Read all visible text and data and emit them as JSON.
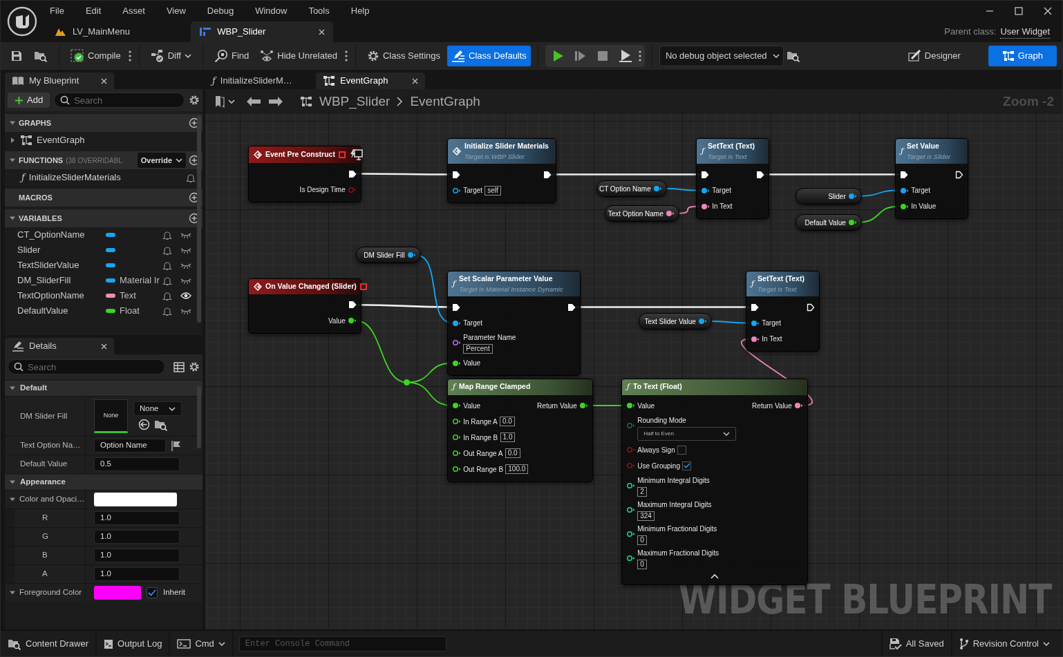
{
  "menu": [
    "File",
    "Edit",
    "Asset",
    "View",
    "Debug",
    "Window",
    "Tools",
    "Help"
  ],
  "document_tabs": [
    {
      "label": "LV_MainMenu",
      "kind": "level",
      "selected": false
    },
    {
      "label": "WBP_Slider",
      "kind": "widget",
      "selected": true
    }
  ],
  "parent_class": {
    "label": "Parent class:",
    "value": "User Widget"
  },
  "toolbar": {
    "compile": "Compile",
    "diff": "Diff",
    "find": "Find",
    "hide_unrelated": "Hide Unrelated",
    "class_modes": [
      {
        "label": "Class Settings",
        "kind": "settings",
        "selected": false
      },
      {
        "label": "Class Defaults",
        "kind": "defaults",
        "selected": true
      }
    ],
    "debug_object": "No debug object selected"
  },
  "editor_modes": [
    {
      "label": "Designer",
      "kind": "designer",
      "selected": false
    },
    {
      "label": "Graph",
      "kind": "graph",
      "selected": true
    }
  ],
  "my_blueprint": {
    "title": "My Blueprint",
    "add": "Add",
    "search_placeholder": "Search",
    "sections": [
      {
        "title": "GRAPHS",
        "items": [
          {
            "label": "EventGraph",
            "kind": "graph",
            "expanded": false
          }
        ]
      },
      {
        "title": "FUNCTIONS",
        "note": "(38 OVERRIDABL",
        "override": "Override",
        "items": [
          {
            "label": "InitializeSliderMaterials",
            "kind": "function",
            "glyph": "ƒ"
          }
        ]
      },
      {
        "title": "MACROS"
      },
      {
        "title": "VARIABLES",
        "variables": [
          {
            "name": "CT_OptionName",
            "color": "#16a6f2",
            "public": false
          },
          {
            "name": "Slider",
            "color": "#16a6f2",
            "public": false
          },
          {
            "name": "TextSliderValue",
            "color": "#16a6f2",
            "public": false
          },
          {
            "name": "DM_SliderFill",
            "color": "#16a6f2",
            "type": "Material Ir",
            "public": false
          },
          {
            "name": "TextOptionName",
            "color": "#f08cba",
            "type": "Text",
            "public": true
          },
          {
            "name": "DefaultValue",
            "color": "#3ed422",
            "type": "Float",
            "public": false
          }
        ]
      }
    ]
  },
  "details": {
    "title": "Details",
    "search_placeholder": "Search",
    "sections": [
      {
        "title": "Default",
        "rows": [
          {
            "kind": "asset",
            "label": "DM Slider Fill",
            "thumbnail": "None",
            "value": "None"
          },
          {
            "kind": "text",
            "label": "Text Option Na…",
            "value": "Option Name"
          },
          {
            "kind": "number",
            "label": "Default Value",
            "value": "0.5"
          }
        ]
      },
      {
        "title": "Appearance",
        "rows": [
          {
            "kind": "color",
            "label": "Color and Opaci…",
            "color": "#ffffff",
            "expanded": true,
            "children": [
              {
                "label": "R",
                "value": "1.0"
              },
              {
                "label": "G",
                "value": "1.0"
              },
              {
                "label": "B",
                "value": "1.0"
              },
              {
                "label": "A",
                "value": "1.0"
              }
            ]
          },
          {
            "kind": "color",
            "label": "Foreground Color",
            "color": "#ff00ff",
            "expanded": true,
            "inherit": {
              "label": "Inherit",
              "checked": true
            }
          }
        ]
      }
    ]
  },
  "graph": {
    "tabs": [
      {
        "label": "InitializeSliderM…",
        "kind": "function",
        "glyph": "ƒ",
        "selected": false
      },
      {
        "label": "EventGraph",
        "kind": "graph",
        "selected": true
      }
    ],
    "breadcrumb": [
      "WBP_Slider",
      "EventGraph"
    ],
    "zoom": "Zoom -2",
    "corner_text": "WIDGET BLUEPRINT",
    "nodes": [
      {
        "kind": "event",
        "title": "Event Pre Construct",
        "design_time": true,
        "outputs": [
          {
            "kind": "exec",
            "connected": true
          },
          {
            "kind": "bool",
            "label": "Is Design Time",
            "connected": false
          }
        ]
      },
      {
        "kind": "call",
        "title": "Initialize Slider Materials",
        "subtitle": "Target is WBP Slider",
        "inputs": [
          {
            "kind": "exec",
            "connected": true
          },
          {
            "kind": "object",
            "label": "Target",
            "value": "self",
            "connected": false
          }
        ],
        "outputs": [
          {
            "kind": "exec",
            "connected": true
          }
        ]
      },
      {
        "kind": "function",
        "glyph": "ƒ",
        "title": "SetText (Text)",
        "subtitle": "Target is Text",
        "inputs": [
          {
            "kind": "exec",
            "connected": true
          },
          {
            "kind": "object",
            "label": "Target",
            "connected": true
          },
          {
            "kind": "text",
            "label": "In Text",
            "connected": true
          }
        ],
        "outputs": [
          {
            "kind": "exec",
            "connected": true
          }
        ]
      },
      {
        "kind": "function",
        "glyph": "ƒ",
        "title": "Set Value",
        "subtitle": "Target is Slider",
        "inputs": [
          {
            "kind": "exec",
            "connected": true
          },
          {
            "kind": "object",
            "label": "Target",
            "connected": true
          },
          {
            "kind": "float",
            "label": "In Value",
            "connected": true
          }
        ],
        "outputs": [
          {
            "kind": "exec",
            "connected": false
          }
        ]
      },
      {
        "kind": "variable",
        "title": "CT Option Name",
        "outputs": [
          {
            "kind": "object",
            "connected": true
          }
        ]
      },
      {
        "kind": "variable",
        "title": "Text Option Name",
        "outputs": [
          {
            "kind": "text",
            "connected": true
          }
        ]
      },
      {
        "kind": "variable",
        "title": "Slider",
        "outputs": [
          {
            "kind": "object",
            "connected": true
          }
        ]
      },
      {
        "kind": "variable",
        "title": "Default Value",
        "outputs": [
          {
            "kind": "float",
            "connected": true
          }
        ]
      },
      {
        "kind": "variable",
        "title": "DM Slider Fill",
        "outputs": [
          {
            "kind": "object",
            "connected": true
          }
        ]
      },
      {
        "kind": "event",
        "title": "On Value Changed (Slider)",
        "design_time": false,
        "outputs": [
          {
            "kind": "exec",
            "connected": true
          },
          {
            "kind": "float",
            "label": "Value",
            "connected": true
          }
        ]
      },
      {
        "kind": "function",
        "glyph": "ƒ",
        "title": "Set Scalar Parameter Value",
        "subtitle": "Target is Material Instance Dynamic",
        "inputs": [
          {
            "kind": "exec",
            "connected": true
          },
          {
            "kind": "object",
            "label": "Target",
            "connected": true
          },
          {
            "kind": "name",
            "label": "Parameter Name",
            "value": "Percent",
            "connected": false
          },
          {
            "kind": "float",
            "label": "Value",
            "connected": true
          }
        ],
        "outputs": [
          {
            "kind": "exec",
            "connected": true
          }
        ]
      },
      {
        "kind": "function",
        "glyph": "ƒ",
        "title": "SetText (Text)",
        "subtitle": "Target is Text",
        "inputs": [
          {
            "kind": "exec",
            "connected": true
          },
          {
            "kind": "object",
            "label": "Target",
            "connected": true
          },
          {
            "kind": "text",
            "label": "In Text",
            "connected": true
          }
        ],
        "outputs": [
          {
            "kind": "exec",
            "connected": false
          }
        ]
      },
      {
        "kind": "variable",
        "title": "Text Slider Value",
        "outputs": [
          {
            "kind": "object",
            "connected": true
          }
        ]
      },
      {
        "kind": "pure",
        "glyph": "ƒ",
        "title": "Map Range Clamped",
        "inputs": [
          {
            "kind": "float",
            "label": "Value",
            "connected": true
          },
          {
            "kind": "float",
            "label": "In Range A",
            "value": "0.0",
            "connected": false
          },
          {
            "kind": "float",
            "label": "In Range B",
            "value": "1.0",
            "connected": false
          },
          {
            "kind": "float",
            "label": "Out Range A",
            "value": "0.0",
            "connected": false
          },
          {
            "kind": "float",
            "label": "Out Range B",
            "value": "100.0",
            "connected": false
          }
        ],
        "outputs": [
          {
            "kind": "float",
            "label": "Return Value",
            "connected": true
          }
        ]
      },
      {
        "kind": "pure",
        "glyph": "ƒ",
        "title": "To Text (Float)",
        "advanced_expanded": true,
        "inputs": [
          {
            "kind": "float",
            "label": "Value",
            "connected": true
          },
          {
            "kind": "enum",
            "label": "Rounding Mode",
            "value": "Half to Even",
            "connected": false
          },
          {
            "kind": "bool",
            "label": "Always Sign",
            "checked": false,
            "connected": false
          },
          {
            "kind": "bool",
            "label": "Use Grouping",
            "checked": true,
            "connected": false
          },
          {
            "kind": "int",
            "label": "Minimum Integral Digits",
            "value": "2",
            "connected": false
          },
          {
            "kind": "int",
            "label": "Maximum Integral Digits",
            "value": "324",
            "connected": false
          },
          {
            "kind": "int",
            "label": "Minimum Fractional Digits",
            "value": "0",
            "connected": false
          },
          {
            "kind": "int",
            "label": "Maximum Fractional Digits",
            "value": "0",
            "connected": false
          }
        ],
        "outputs": [
          {
            "kind": "text",
            "label": "Return Value",
            "connected": true
          }
        ]
      }
    ]
  },
  "status_bar": {
    "content_drawer": "Content Drawer",
    "output_log": "Output Log",
    "cmd": "Cmd",
    "console_placeholder": "Enter Console Command",
    "saved": "All Saved",
    "revision_control": "Revision Control"
  }
}
